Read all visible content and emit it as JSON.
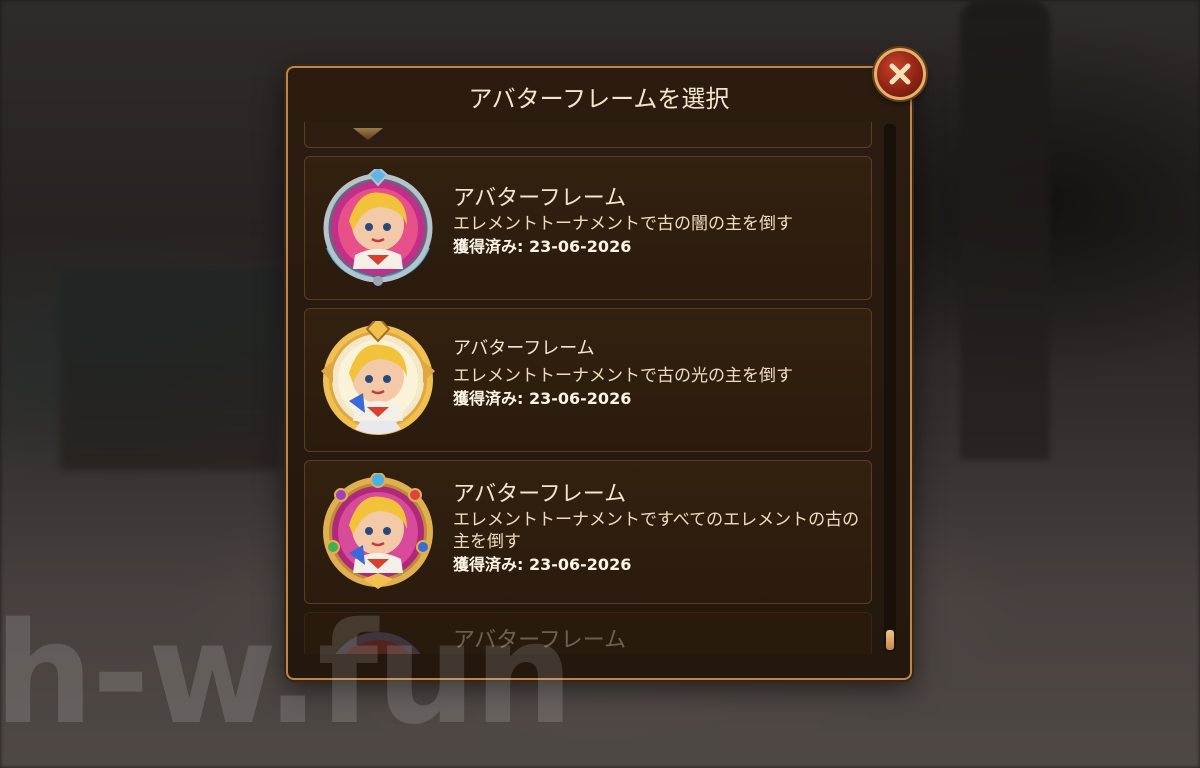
{
  "dialog": {
    "title": "アバターフレームを選択",
    "close_icon": "close-x-icon"
  },
  "frames": [
    {
      "name": "アバターフレーム",
      "description": "エレメントトーナメントで古の闇の主を倒す",
      "earned_label": "獲得済み",
      "earned_date": "23-06-2026",
      "frame_color": "#9aa6b2",
      "accent_color": "#c0308a"
    },
    {
      "name": "アバターフレーム",
      "description": "エレメントトーナメントで古の光の主を倒す",
      "earned_label": "獲得済み",
      "earned_date": "23-06-2026",
      "frame_color": "#e0a640",
      "accent_color": "#f4e8c8"
    },
    {
      "name": "アバターフレーム",
      "description": "エレメントトーナメントですべてのエレメントの古の主を倒す",
      "earned_label": "獲得済み",
      "earned_date": "23-06-2026",
      "frame_color": "#d8a040",
      "accent_color": "#b0287a"
    },
    {
      "name": "アバターフレーム",
      "frame_color": "#6e6a90",
      "accent_color": "#a04040"
    }
  ],
  "watermark": "h-w.fun",
  "colors": {
    "dialog_border": "#b8864e",
    "card_background": "#2f1e10",
    "text": "#f3e6cf",
    "close_button": "#a8301c"
  }
}
